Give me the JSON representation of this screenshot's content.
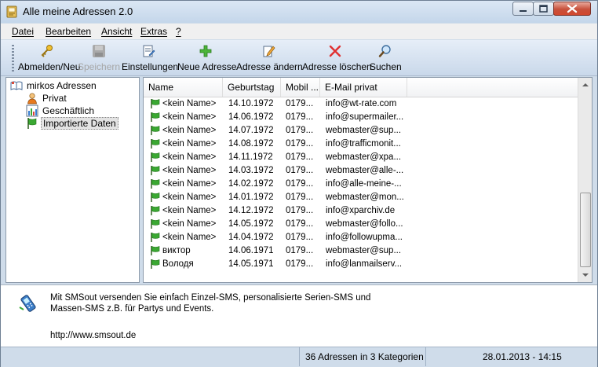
{
  "window": {
    "title": "Alle meine Adressen 2.0"
  },
  "menu": [
    {
      "label": "Datei"
    },
    {
      "label": "Bearbeiten"
    },
    {
      "label": "Ansicht"
    },
    {
      "label": "Extras"
    },
    {
      "label": "?"
    }
  ],
  "toolbar": {
    "login": "Abmelden/Neu",
    "save": "Speichern",
    "settings": "Einstellungen",
    "new_address": "Neue Adresse",
    "edit_address": "Adresse ändern",
    "delete_address": "Adresse löschen",
    "search": "Suchen"
  },
  "tree": {
    "root": "mirkos Adressen",
    "children": [
      "Privat",
      "Geschäftlich",
      "Importierte Daten"
    ],
    "selected": "Importierte Daten"
  },
  "list": {
    "columns": [
      "Name",
      "Geburtstag",
      "Mobil ...",
      "E-Mail privat"
    ],
    "rows": [
      {
        "name": "<kein Name>",
        "birthday": "14.10.1972",
        "mobile": "0179...",
        "email": "info@wt-rate.com"
      },
      {
        "name": "<kein Name>",
        "birthday": "14.06.1972",
        "mobile": "0179...",
        "email": "info@supermailer..."
      },
      {
        "name": "<kein Name>",
        "birthday": "14.07.1972",
        "mobile": "0179...",
        "email": "webmaster@sup..."
      },
      {
        "name": "<kein Name>",
        "birthday": "14.08.1972",
        "mobile": "0179...",
        "email": "info@trafficmonit..."
      },
      {
        "name": "<kein Name>",
        "birthday": "14.11.1972",
        "mobile": "0179...",
        "email": "webmaster@xpa..."
      },
      {
        "name": "<kein Name>",
        "birthday": "14.03.1972",
        "mobile": "0179...",
        "email": "webmaster@alle-..."
      },
      {
        "name": "<kein Name>",
        "birthday": "14.02.1972",
        "mobile": "0179...",
        "email": "info@alle-meine-..."
      },
      {
        "name": "<kein Name>",
        "birthday": "14.01.1972",
        "mobile": "0179...",
        "email": "webmaster@mon..."
      },
      {
        "name": "<kein Name>",
        "birthday": "14.12.1972",
        "mobile": "0179...",
        "email": "info@xparchiv.de"
      },
      {
        "name": "<kein Name>",
        "birthday": "14.05.1972",
        "mobile": "0179...",
        "email": "webmaster@follo..."
      },
      {
        "name": "<kein Name>",
        "birthday": "14.04.1972",
        "mobile": "0179...",
        "email": "info@followupma..."
      },
      {
        "name": "виктор",
        "birthday": "14.06.1971",
        "mobile": "0179...",
        "email": "webmaster@sup..."
      },
      {
        "name": "Володя",
        "birthday": "14.05.1971",
        "mobile": "0179...",
        "email": "info@lanmailserv..."
      }
    ]
  },
  "info": {
    "line1": "Mit SMSout versenden Sie einfach Einzel-SMS, personalisierte Serien-SMS und",
    "line2": "Massen-SMS z.B. für Partys und Events.",
    "link": "http://www.smsout.de"
  },
  "status": {
    "count": "36 Adressen in 3 Kategorien",
    "datetime": "28.01.2013 - 14:15"
  },
  "icons": {
    "app": "address-book-icon",
    "flag_color": "#3aa832",
    "close_color": "#c7503b"
  }
}
